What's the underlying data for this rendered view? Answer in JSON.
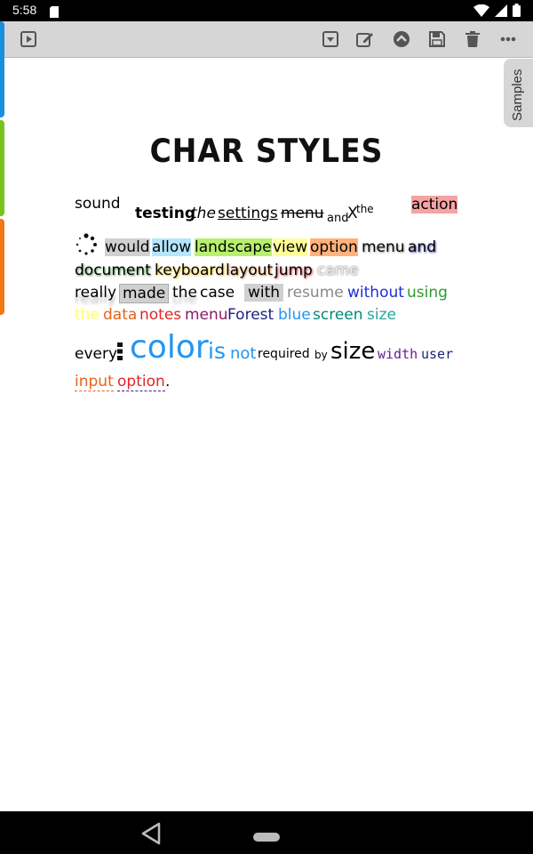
{
  "status": {
    "time": "5:58",
    "icons": [
      "sd-card-icon",
      "wifi-icon",
      "signal-icon",
      "battery-icon"
    ]
  },
  "toolbar": {
    "buttons": [
      "play-icon",
      "dropdown-icon",
      "edit-icon",
      "collapse-icon",
      "save-icon",
      "delete-icon",
      "more-icon"
    ]
  },
  "side_tabs": {
    "colors": [
      "#1a8fe0",
      "#79c41c",
      "#f07a12"
    ]
  },
  "samples": {
    "label": "Samples"
  },
  "title": "CHAR STYLES",
  "line1": {
    "w1": "sound",
    "w2": "testing",
    "w3": "the",
    "w4": "settings",
    "w5": "menu",
    "w6": "and",
    "w7": "X",
    "w8": "the",
    "w9": "action"
  },
  "line2": {
    "w1": "would",
    "w2": "allow",
    "w3": "landscape",
    "w4": "view",
    "w5": "option",
    "w6": "menu",
    "w7": "and"
  },
  "line3": {
    "w1": "document",
    "w2": "keyboard",
    "w3": "layout",
    "w4": "jump",
    "w5": "came"
  },
  "line4": {
    "w1": "really",
    "w2": "made",
    "w3": "the",
    "w4": "case",
    "w5": "with",
    "w6": "resume",
    "w7": "without",
    "w8": "using"
  },
  "line5": {
    "w1": "the",
    "w2": "data",
    "w3": "notes",
    "w4": "menu",
    "w5": "Forest",
    "w6": "blue",
    "w7": "screen",
    "w8": "size"
  },
  "line6": {
    "w1": "every",
    "w2": "color",
    "w3": "is",
    "w4": "not",
    "w5": "required",
    "w6": "by",
    "w7": "size",
    "w8": "width",
    "w9": "user"
  },
  "line7": {
    "w1": "input",
    "w2": "option",
    "w3": "."
  },
  "colors": {
    "gray_hl": "#d0d0d0",
    "blue_hl": "#b3e5fc",
    "green_hl": "#b7f06c",
    "yellow_hl": "#ffff99",
    "orange_hl": "#ffb27a",
    "red_hl": "#f5a3a3",
    "accent_blue": "#2196f3"
  }
}
